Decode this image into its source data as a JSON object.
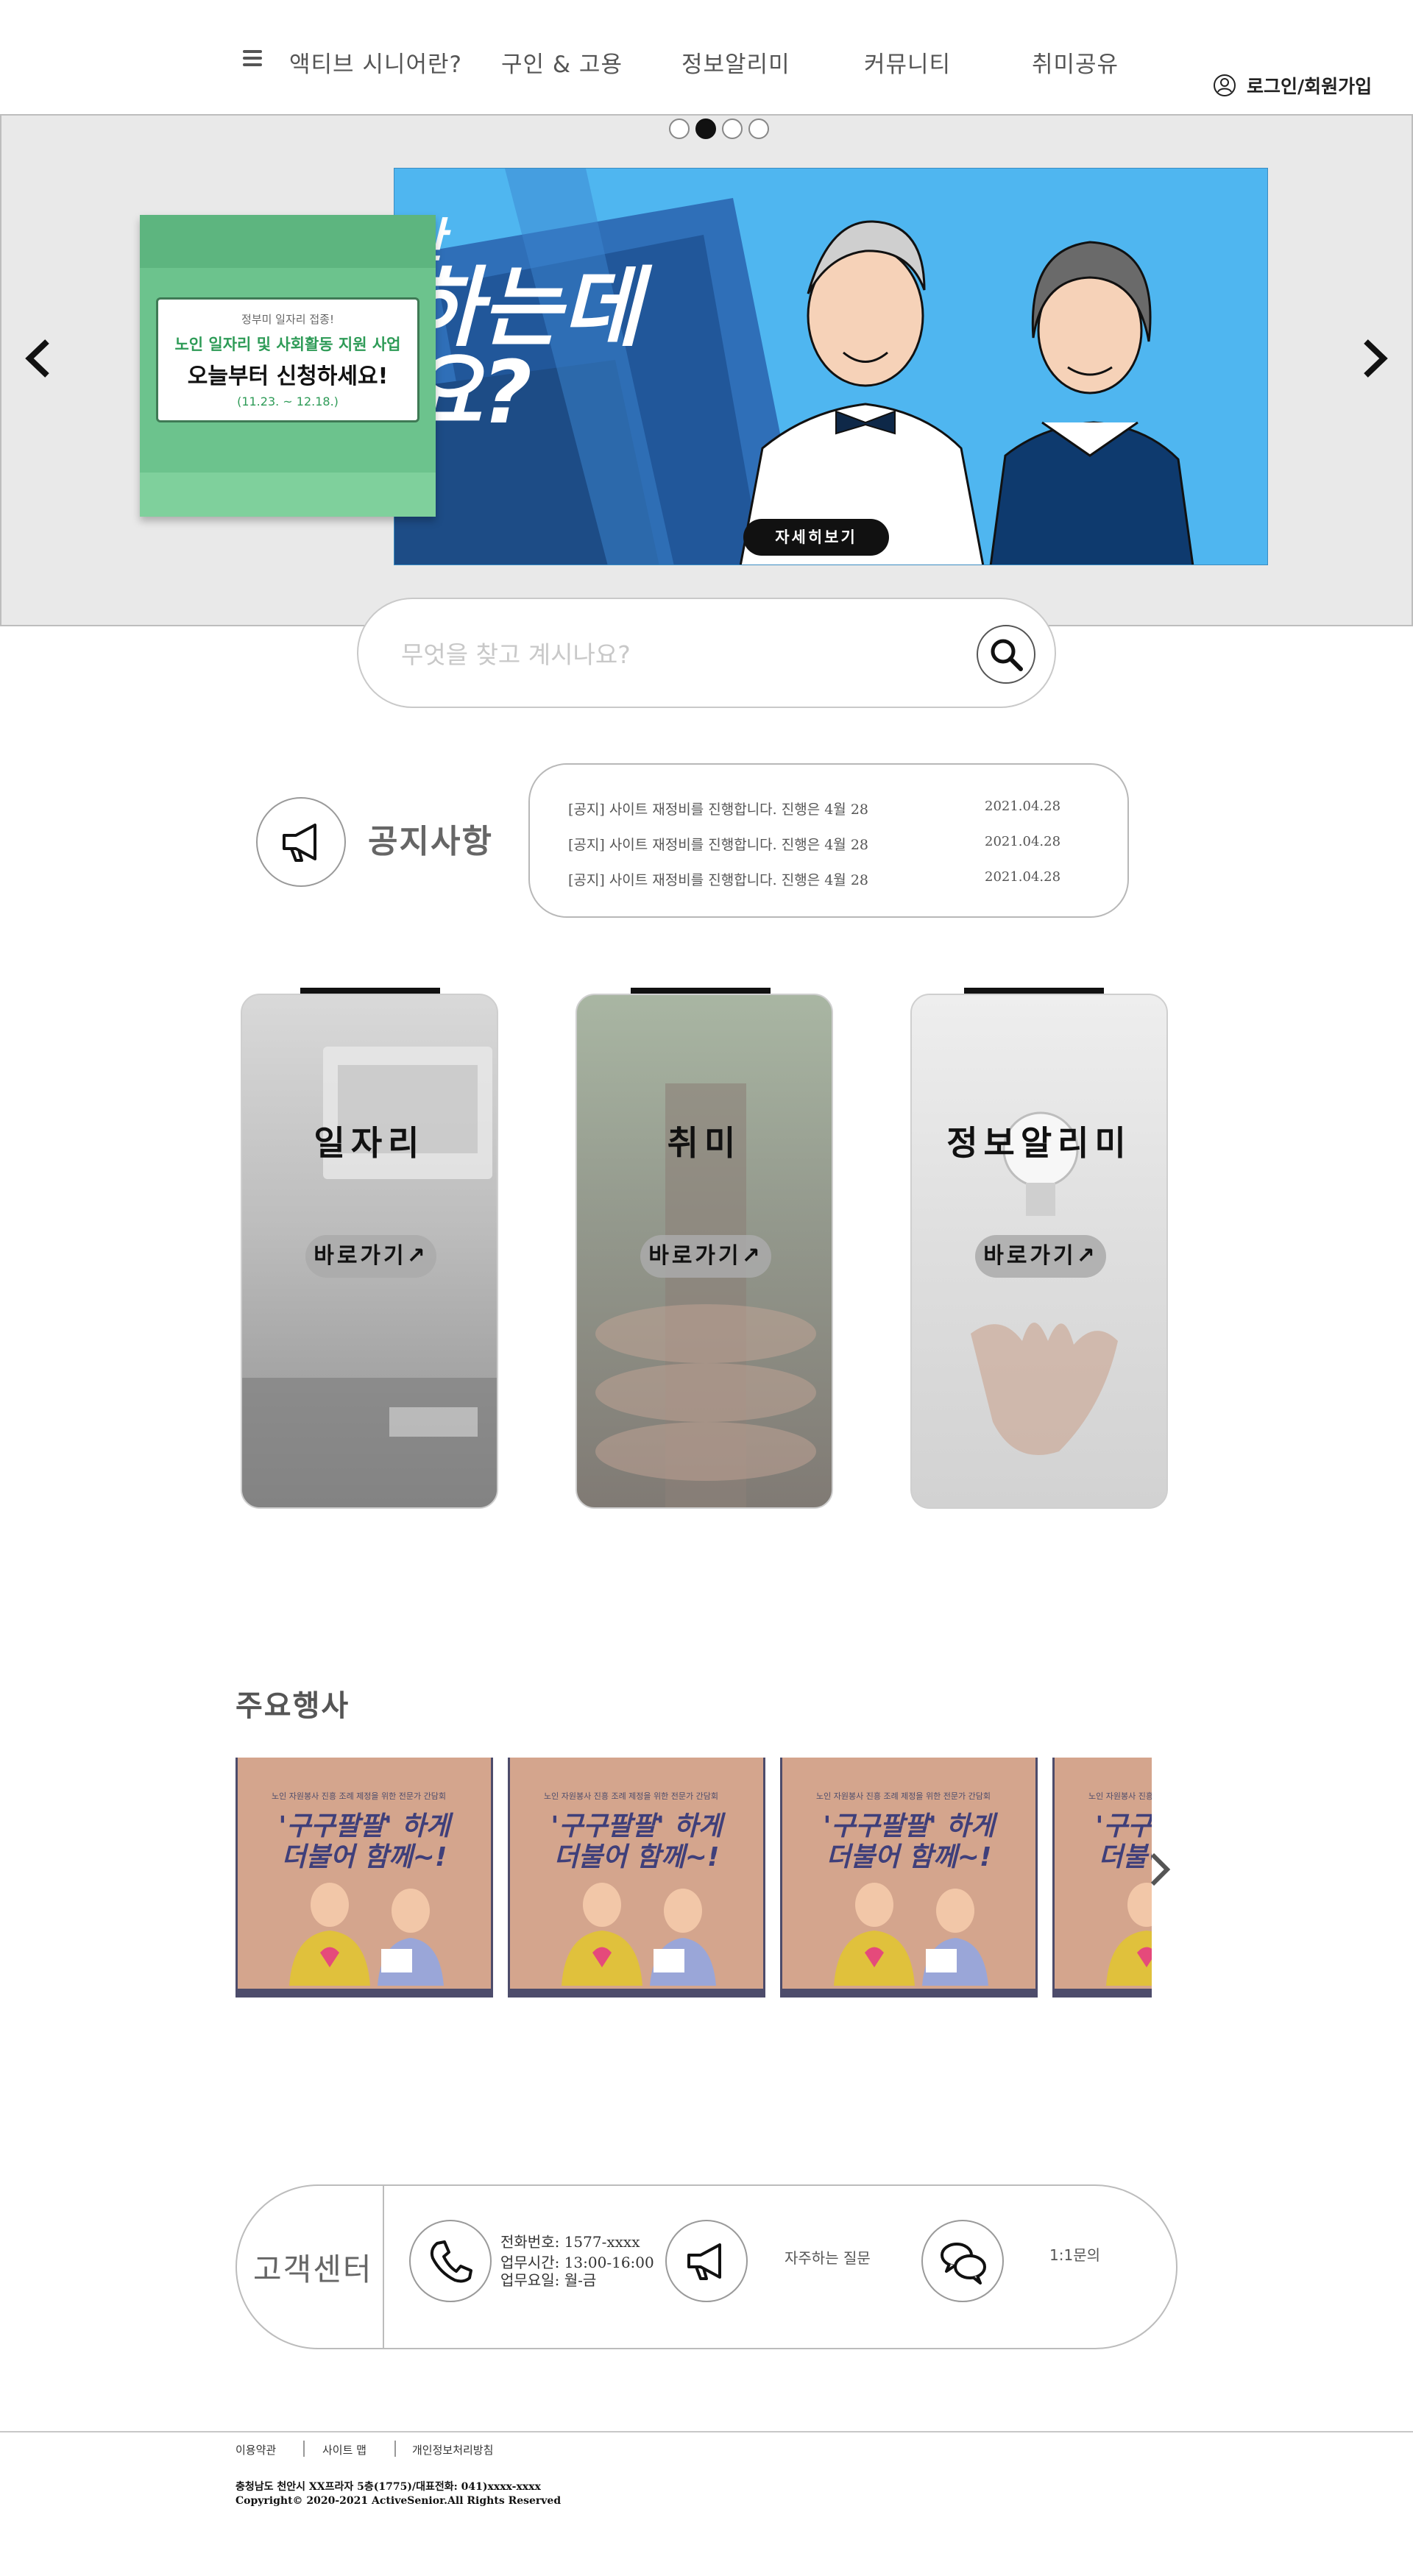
{
  "header": {
    "nav": [
      "액티브 시니어란?",
      "구인 & 고용",
      "정보알리미",
      "커뮤니티",
      "취미공유"
    ],
    "login": "로그인/회원가입"
  },
  "banner": {
    "slides_total": 4,
    "active_slide": 2,
    "green_poster": {
      "sub": "정부미 일자리 접종!",
      "line1": "노인 일자리 및 사회활동 지원 사업",
      "line2": "오늘부터 신청하세요!",
      "dates": "(11.23. ~ 12.18.)"
    },
    "blue_poster": {
      "big1": "간",
      "big2": "하는데",
      "big3": "요?"
    },
    "detail_button": "자세히보기"
  },
  "search": {
    "placeholder": "무엇을 찾고 계시나요?"
  },
  "notice": {
    "title": "공지사항",
    "items": [
      {
        "text": "[공지] 사이트 재정비를 진행합니다. 진행은 4월 28",
        "date": "2021.04.28"
      },
      {
        "text": "[공지] 사이트 재정비를 진행합니다. 진행은 4월 28",
        "date": "2021.04.28"
      },
      {
        "text": "[공지] 사이트 재정비를 진행합니다. 진행은 4월 28",
        "date": "2021.04.28"
      }
    ]
  },
  "categories": [
    {
      "title": "일자리",
      "button": "바로가기↗"
    },
    {
      "title": "취미",
      "button": "바로가기↗"
    },
    {
      "title": "정보알리미",
      "button": "바로가기↗"
    }
  ],
  "events": {
    "title": "주요행사",
    "card_top": "노인 자원봉사 진흥 조례 제정을 위한 전문가 간담회",
    "card_h1": "'구구팔팔' 하게",
    "card_h2": "더불어 함께~!"
  },
  "customer_center": {
    "title": "고객센터",
    "phone": "전화번호: 1577-xxxx",
    "hours": "업무시간: 13:00-16:00",
    "days": "업무요일: 월-금",
    "faq": "자주하는 질문",
    "inquiry": "1:1문의"
  },
  "footer": {
    "links": [
      "이용약관",
      "사이트 맵",
      "개인정보처리방침"
    ],
    "address": "충청남도 천안시 XX프라자 5층(1775)/대표전화: 041)xxxx-xxxx",
    "copyright": "Copyright© 2020-2021 ActiveSenior.All Rights Reserved"
  },
  "colors": {
    "banner_bg": "#e9e9e9",
    "green_poster": "#6cc38d",
    "blue_poster": "#4fb6f0",
    "event_card": "#d4a58d",
    "event_text": "#3f3f7a"
  }
}
